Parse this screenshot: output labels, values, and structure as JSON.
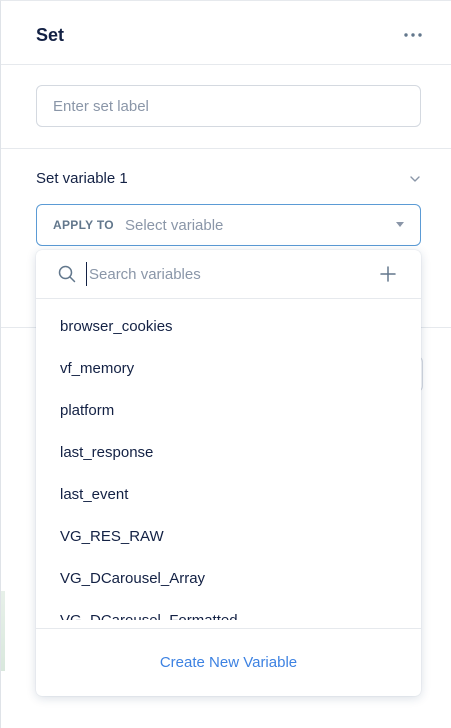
{
  "header": {
    "title": "Set",
    "more_icon": "more-horizontal-icon"
  },
  "label_input": {
    "placeholder": "Enter set label",
    "value": ""
  },
  "set_variable": {
    "title": "Set variable 1",
    "collapse_icon": "chevron-down-icon",
    "apply_to_label": "APPLY TO",
    "select_placeholder": "Select variable"
  },
  "dropdown": {
    "search_placeholder": "Search variables",
    "search_icon": "search-icon",
    "add_icon": "plus-icon",
    "items": [
      "browser_cookies",
      "vf_memory",
      "platform",
      "last_response",
      "last_event",
      "VG_RES_RAW",
      "VG_DCarousel_Array",
      "VG_DCarousel_Formatted"
    ],
    "create_label": "Create New Variable"
  },
  "colors": {
    "accent": "#3d82e2",
    "focus_border": "#5b9bd5",
    "text": "#132144",
    "muted": "#8a96a8"
  }
}
